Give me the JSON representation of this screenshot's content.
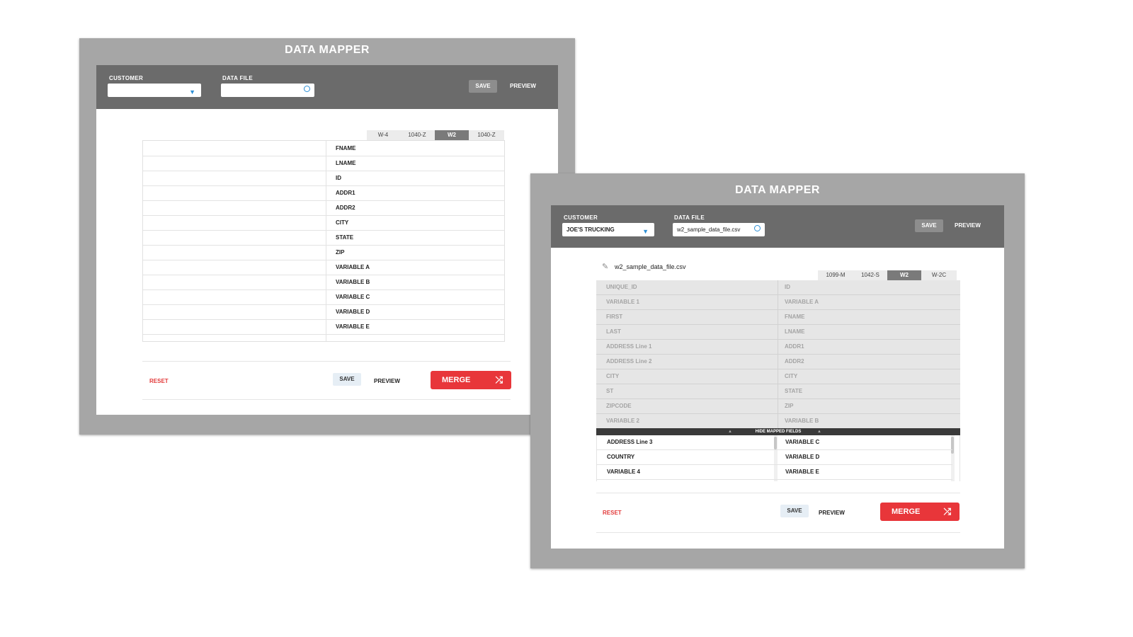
{
  "window1": {
    "title": "DATA MAPPER",
    "customer_label": "CUSTOMER",
    "customer_value": "",
    "datafile_label": "DATA FILE",
    "datafile_value": "",
    "toolbar_save": "SAVE",
    "toolbar_preview": "PREVIEW",
    "tabs": [
      "W-4",
      "1040-Z",
      "W2",
      "1040-Z"
    ],
    "active_tab": "W2",
    "fields": [
      "FNAME",
      "LNAME",
      "ID",
      "ADDR1",
      "ADDR2",
      "CITY",
      "STATE",
      "ZIP",
      "VARIABLE A",
      "VARIABLE B",
      "VARIABLE C",
      "VARIABLE D",
      "VARIABLE E"
    ],
    "reset": "RESET",
    "save": "SAVE",
    "preview": "PREVIEW",
    "merge": "MERGE"
  },
  "window2": {
    "title": "DATA MAPPER",
    "customer_label": "CUSTOMER",
    "customer_value": "JOE'S TRUCKING",
    "datafile_label": "DATA FILE",
    "datafile_value": "w2_sample_data_file.csv",
    "toolbar_save": "SAVE",
    "toolbar_preview": "PREVIEW",
    "file_name": "w2_sample_data_file.csv",
    "tabs": [
      "1099-M",
      "1042-S",
      "W2",
      "W-2C"
    ],
    "active_tab": "W2",
    "mapped_rows": [
      {
        "source": "UNIQUE_ID",
        "target": "ID"
      },
      {
        "source": "VARIABLE 1",
        "target": "VARIABLE A"
      },
      {
        "source": "FIRST",
        "target": "FNAME"
      },
      {
        "source": "LAST",
        "target": "LNAME"
      },
      {
        "source": "ADDRESS Line 1",
        "target": "ADDR1"
      },
      {
        "source": "ADDRESS Line 2",
        "target": "ADDR2"
      },
      {
        "source": "CITY",
        "target": "CITY"
      },
      {
        "source": "ST",
        "target": "STATE"
      },
      {
        "source": "ZIPCODE",
        "target": "ZIP"
      },
      {
        "source": "VARIABLE 2",
        "target": "VARIABLE B"
      }
    ],
    "hide_mapped_label": "HIDE MAPPED FIELDS",
    "unmapped_rows": [
      {
        "source": "ADDRESS Line 3",
        "target": "VARIABLE C"
      },
      {
        "source": "COUNTRY",
        "target": "VARIABLE D"
      },
      {
        "source": "VARIABLE 4",
        "target": "VARIABLE E"
      }
    ],
    "reset": "RESET",
    "save": "SAVE",
    "preview": "PREVIEW",
    "merge": "MERGE"
  },
  "colors": {
    "frame": "#a6a6a6",
    "toolbar": "#6b6b6b",
    "accent_red": "#e8363a",
    "select_caret_blue": "#2d8fd5",
    "mapped_bg": "#e6e6e6",
    "hide_bar": "#3a3a3a"
  },
  "icons": {
    "select_arrow": "triangle-down-icon",
    "clear": "clear-circle-icon",
    "shuffle": "shuffle-icon",
    "paperclip": "paperclip-icon",
    "collapse": "triangle-up-icon"
  }
}
